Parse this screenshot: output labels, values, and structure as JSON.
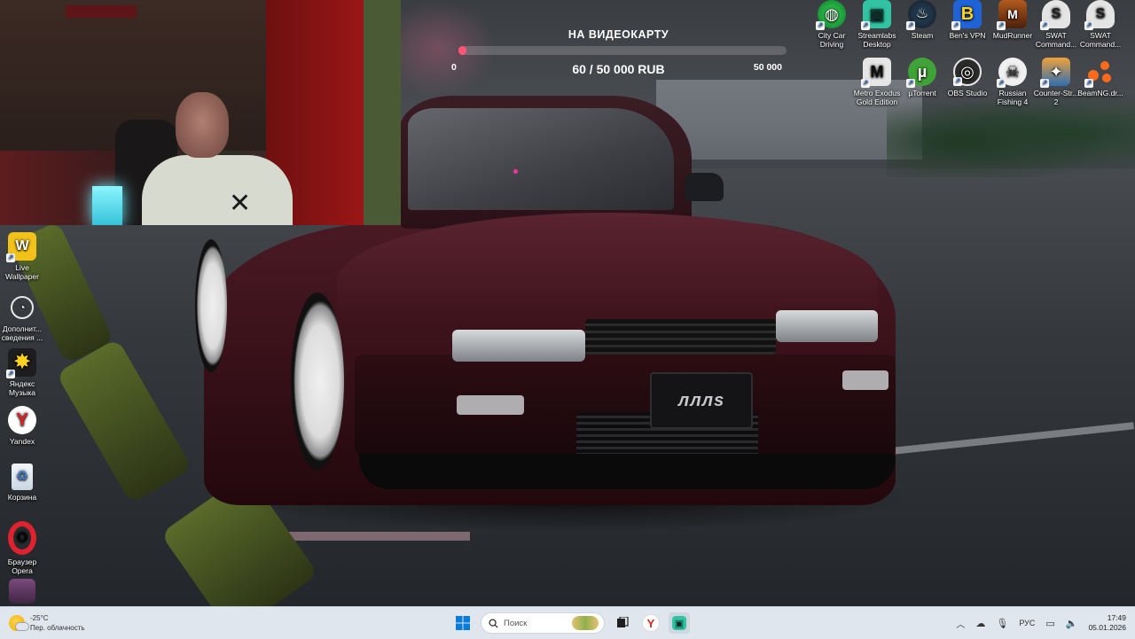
{
  "donation_goal": {
    "title": "НА ВИДЕОКАРТУ",
    "min_label": "0",
    "max_label": "50 000",
    "amount_label": "60 / 50 000 RUB",
    "progress_fraction": 0.0012,
    "bar_color": "#ff5577"
  },
  "wallpaper": {
    "plate_text": "лллs"
  },
  "desktop_icons_left": [
    {
      "label": "Live Wallpaper",
      "icon": "live-wallpaper-icon",
      "color": "#f2c21a",
      "glyph": "W"
    },
    {
      "label": "Дополнит... сведения ...",
      "icon": "speedometer-icon",
      "color": "transparent",
      "glyph": "◔"
    },
    {
      "label": "Яндекс Музыка",
      "icon": "yandex-music-icon",
      "color": "#1d1d1f",
      "glyph": "✸"
    },
    {
      "label": "Yandex",
      "icon": "yandex-browser-icon",
      "color": "#ffffff",
      "glyph": "Y"
    },
    {
      "label": "Корзина",
      "icon": "recycle-bin-icon",
      "color": "transparent",
      "glyph": "♻"
    },
    {
      "label": "Браузер Opera",
      "icon": "opera-icon",
      "color": "transparent",
      "glyph": "O"
    },
    {
      "label": "",
      "icon": "user-avatar-icon",
      "color": "#6a3d6b",
      "glyph": ""
    }
  ],
  "desktop_icons_top_right": [
    {
      "label": "City Car Driving",
      "icon": "city-car-driving-icon",
      "color": "#1e9e3a",
      "glyph": "◍"
    },
    {
      "label": "Streamlabs Desktop",
      "icon": "streamlabs-icon",
      "color": "#31c3a2",
      "glyph": "▣"
    },
    {
      "label": "Steam",
      "icon": "steam-icon",
      "color": "#1b2838",
      "glyph": "♨"
    },
    {
      "label": "Ben's VPN",
      "icon": "vpn-icon",
      "color": "#1f63d6",
      "glyph": "B"
    },
    {
      "label": "MudRunner",
      "icon": "mudrunner-icon",
      "color": "#7a3b1a",
      "glyph": "M"
    },
    {
      "label": "SWAT Command...",
      "icon": "swat-commander-icon",
      "color": "#d9d9d9",
      "glyph": "S"
    },
    {
      "label": "SWAT Command...",
      "icon": "swat-commander-icon",
      "color": "#d9d9d9",
      "glyph": "S"
    }
  ],
  "desktop_icons_second_row": [
    {
      "label": "Metro Exodus Gold Edition",
      "icon": "metro-exodus-icon",
      "color": "#e6e6e6",
      "glyph": "M"
    },
    {
      "label": "µTorrent",
      "icon": "utorrent-icon",
      "color": "#3fa337",
      "glyph": "µ"
    },
    {
      "label": "OBS Studio",
      "icon": "obs-studio-icon",
      "color": "#2b2b2b",
      "glyph": "◎"
    },
    {
      "label": "Russian Fishing 4",
      "icon": "russian-fishing-icon",
      "color": "#f0f0f0",
      "glyph": "☠"
    },
    {
      "label": "Counter-Str... 2",
      "icon": "counter-strike-icon",
      "color": "#2f6fb3",
      "glyph": "✦"
    },
    {
      "label": "BeamNG.dr...",
      "icon": "beamng-icon",
      "color": "transparent",
      "glyph": "●"
    }
  ],
  "taskbar": {
    "weather_temp": "-25°C",
    "weather_desc": "Пер. облачность",
    "search_placeholder": "Поиск",
    "language": "РУС",
    "time": "17:49",
    "date": "05.01.2026"
  }
}
